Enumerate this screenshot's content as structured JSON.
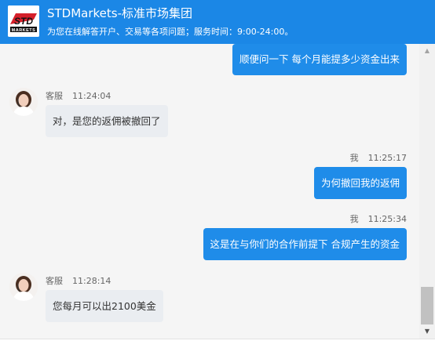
{
  "header": {
    "logo_text": "STD MARKETS",
    "title": "STDMarkets-标准市场集团",
    "subtitle": "为您在线解答开户、交易等各项问题；服务时间：9:00-24:00。"
  },
  "messages": [
    {
      "direction": "out",
      "text": "顺便问一下 每个月能提多少资金出来"
    },
    {
      "direction": "in",
      "sender": "客服",
      "time": "11:24:04",
      "text": "对，是您的返佣被撤回了"
    },
    {
      "direction": "out",
      "sender": "我",
      "time": "11:25:17",
      "text": "为何撤回我的返佣"
    },
    {
      "direction": "out",
      "sender": "我",
      "time": "11:25:34",
      "text": "这是在与你们的合作前提下 合规产生的资金"
    },
    {
      "direction": "in",
      "sender": "客服",
      "time": "11:28:14",
      "text": "您每月可以出2100美金"
    }
  ],
  "icons": {
    "scroll_up": "▲",
    "scroll_down": "▼"
  },
  "colors": {
    "brand_blue": "#1b87e6",
    "outgoing_bubble": "#1f8ce9",
    "incoming_bubble": "#eaedf1"
  }
}
